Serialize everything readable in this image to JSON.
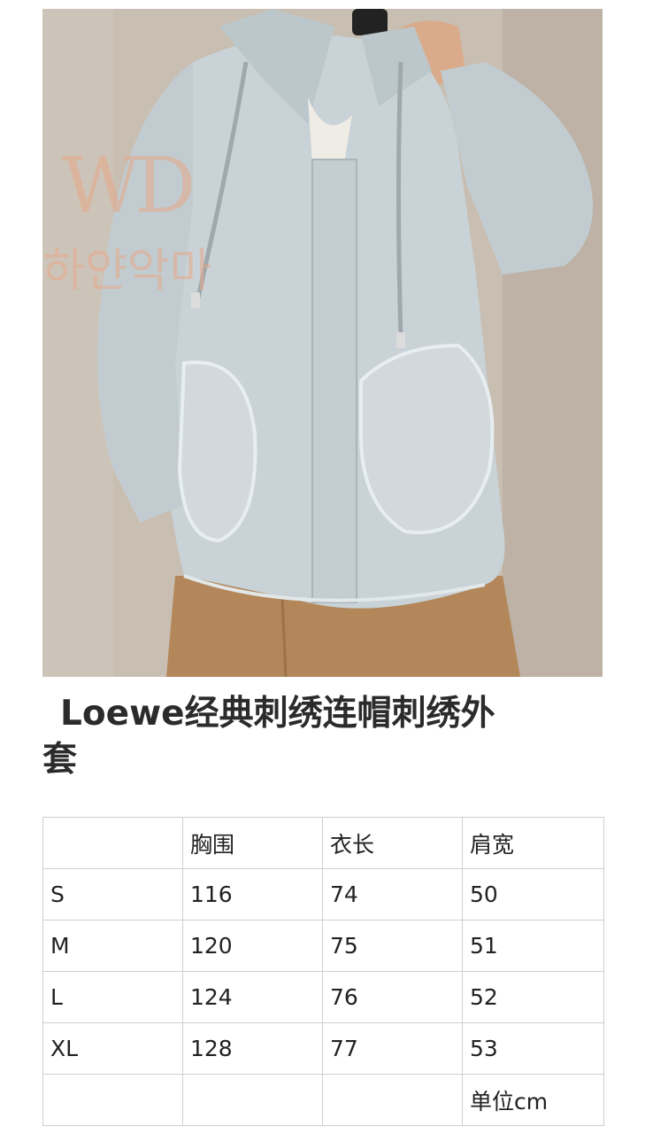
{
  "watermark": {
    "monogram": "WD",
    "korean": "하얀악마"
  },
  "product": {
    "title_line1": "Loewe经典刺绣连帽刺绣外",
    "title_line2": "套"
  },
  "size_table": {
    "headers": [
      "",
      "胸围",
      "衣长",
      "肩宽"
    ],
    "rows": [
      [
        "S",
        "116",
        "74",
        "50"
      ],
      [
        "M",
        "120",
        "75",
        "51"
      ],
      [
        "L",
        "124",
        "76",
        "52"
      ],
      [
        "XL",
        "128",
        "77",
        "53"
      ],
      [
        "",
        "",
        "",
        "单位cm"
      ]
    ]
  },
  "colors": {
    "shirt": "#c9d2d6",
    "pants": "#b4885a",
    "background_wall": "#c9c0b5",
    "watermark": "#e5a887"
  }
}
